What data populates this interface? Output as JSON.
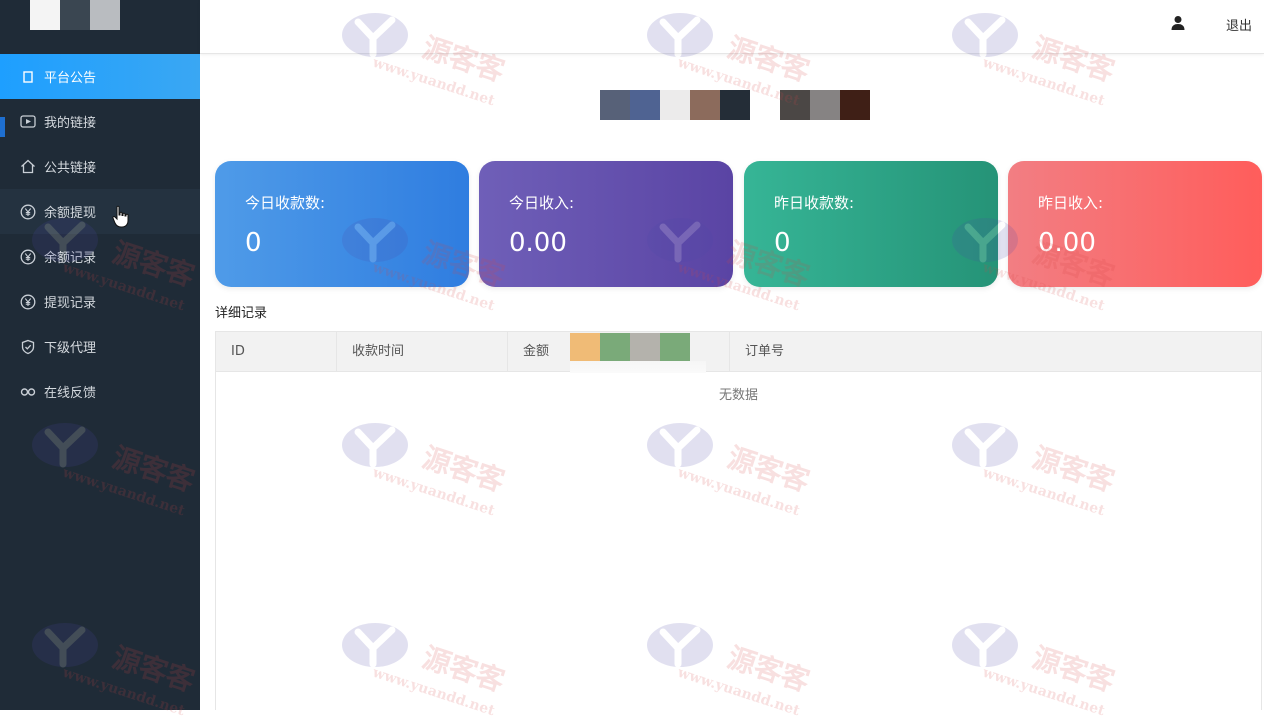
{
  "sidebar": {
    "items": [
      {
        "label": "平台公告",
        "icon": "square-icon"
      },
      {
        "label": "我的链接",
        "icon": "play-box-icon"
      },
      {
        "label": "公共链接",
        "icon": "home-icon"
      },
      {
        "label": "余额提现",
        "icon": "yen-circle-icon"
      },
      {
        "label": "余额记录",
        "icon": "yen-circle-icon"
      },
      {
        "label": "提现记录",
        "icon": "yen-circle-icon"
      },
      {
        "label": "下级代理",
        "icon": "shield-check-icon"
      },
      {
        "label": "在线反馈",
        "icon": "link-icon"
      }
    ]
  },
  "header": {
    "logout_label": "退出"
  },
  "stats": [
    {
      "label": "今日收款数:",
      "value": "0"
    },
    {
      "label": "今日收入:",
      "value": "0.00"
    },
    {
      "label": "昨日收款数:",
      "value": "0"
    },
    {
      "label": "昨日收入:",
      "value": "0.00"
    }
  ],
  "records": {
    "title": "详细记录",
    "columns": [
      "ID",
      "收款时间",
      "金额",
      "订单号"
    ],
    "empty_text": "无数据"
  },
  "watermark": {
    "cn_text": "源客客",
    "url_text": "www.yuandd.net"
  },
  "colors": {
    "sidebar_bg": "#1f2b37",
    "active_item": "#1e9fff",
    "card_blue": "#2f7de0",
    "card_purple": "#5a44a4",
    "card_green": "#259377",
    "card_red": "#ff5d5b"
  }
}
